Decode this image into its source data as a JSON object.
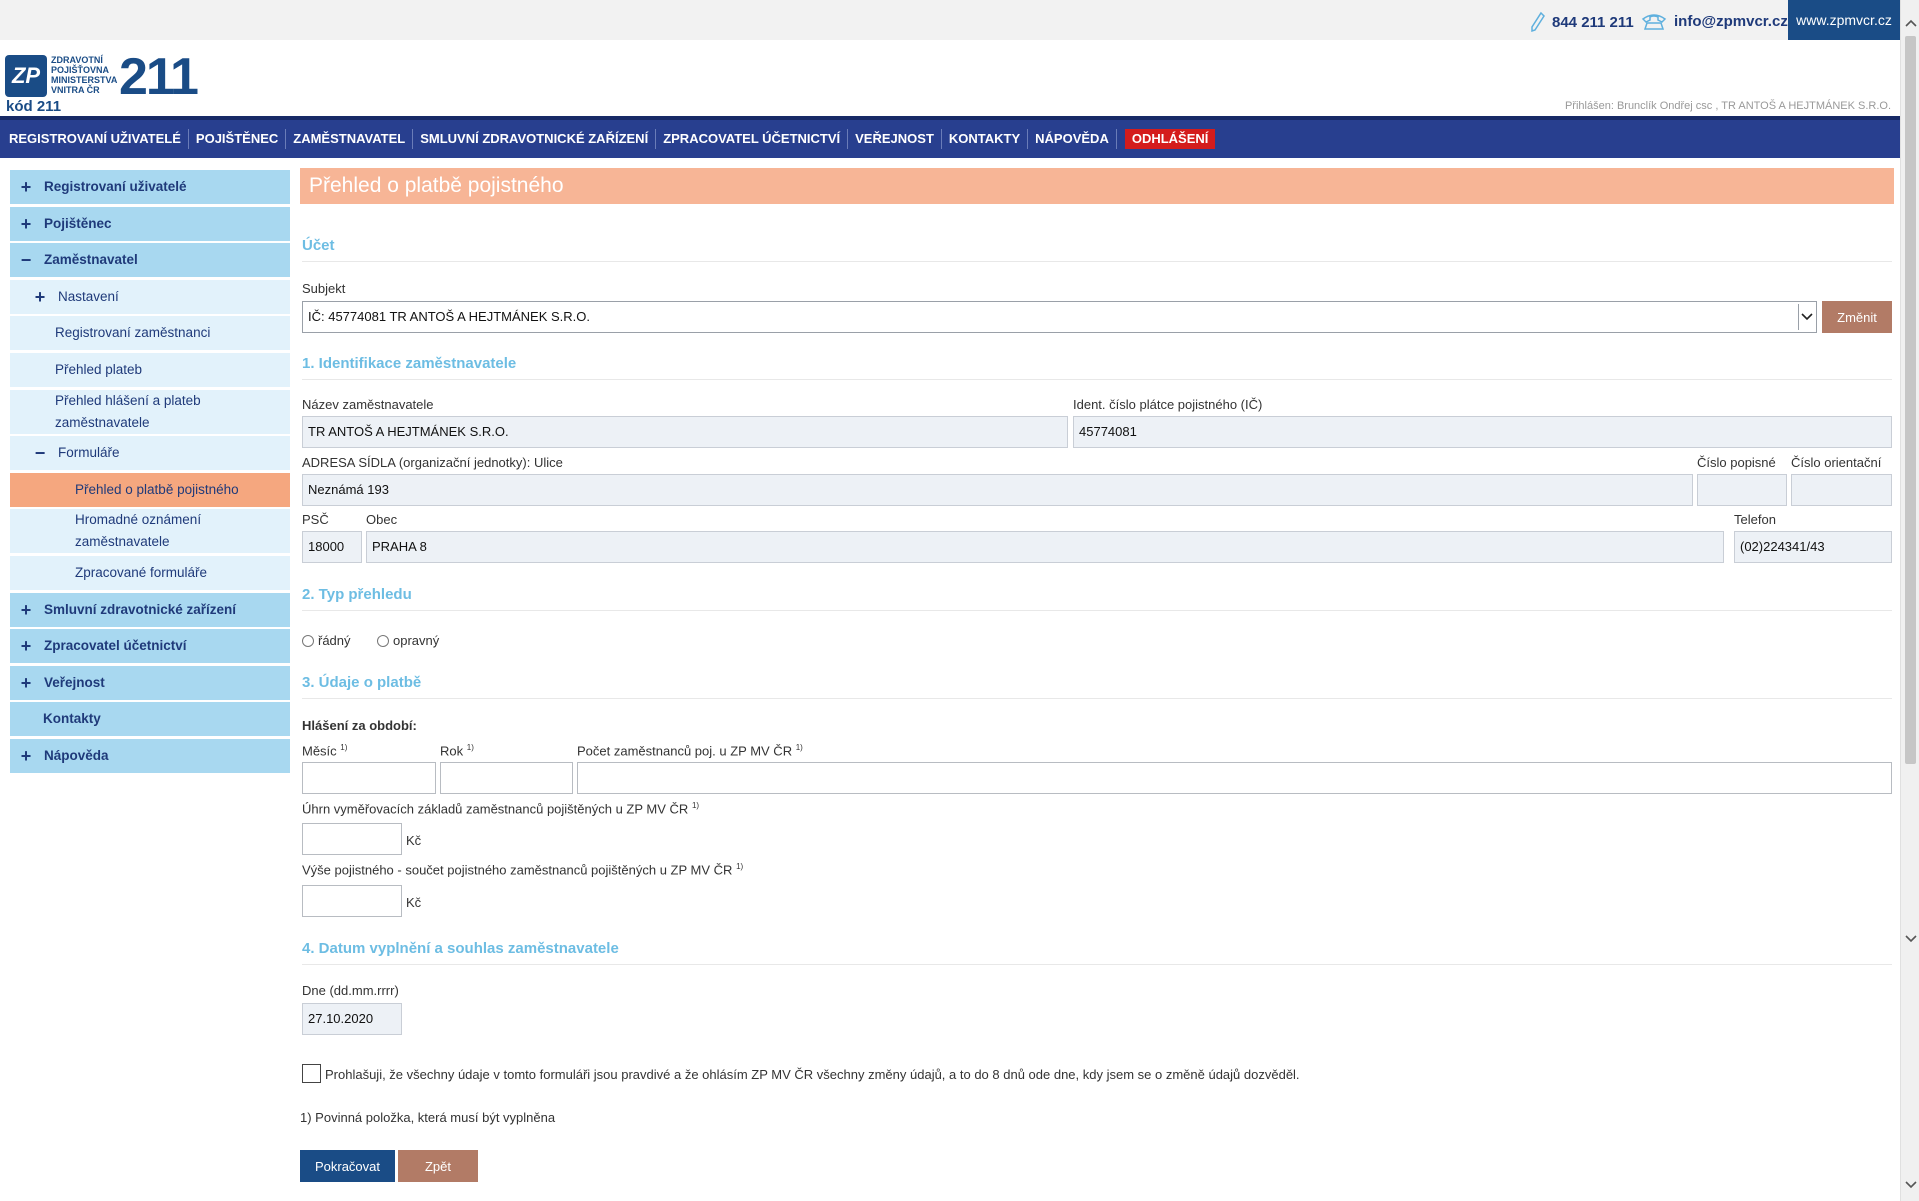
{
  "topbar": {
    "phone": "844 211 211",
    "email": "info@zpmvcr.cz",
    "website": "www.zpmvcr.cz"
  },
  "header": {
    "logo_mark": "ZP",
    "logo_lines": [
      "ZDRAVOTNÍ",
      "POJIŠŤOVNA",
      "MINISTERSTVA",
      "VNITRA ČR"
    ],
    "logo_number": "211",
    "logo_code": "kód 211",
    "login_info": "Přihlášen: Bruncl­ík Ondřej csc , TR ANTOŠ A HEJTMÁNEK S.R.O."
  },
  "nav": {
    "items": [
      "REGISTROVANÍ UŽIVATELÉ",
      "POJIŠTĚNEC",
      "ZAMĚSTNAVATEL",
      "SMLUVNÍ ZDRAVOTNICKÉ ZAŘÍZENÍ",
      "ZPRACOVATEL ÚČETNICTVÍ",
      "VEŘEJNOST",
      "KONTAKTY",
      "NÁPOVĚDA"
    ],
    "logout": "ODHLÁŠENÍ"
  },
  "sidebar": {
    "items": [
      {
        "sign": "+",
        "label": "Registrovaní uživatelé"
      },
      {
        "sign": "+",
        "label": "Pojištěnec"
      },
      {
        "sign": "−",
        "label": "Zaměstnavatel"
      },
      {
        "sign": "+",
        "label": "Nastavení"
      },
      {
        "sign": "",
        "label": "Registrovaní zaměstnanci"
      },
      {
        "sign": "",
        "label": "Přehled plateb"
      },
      {
        "sign": "",
        "label": "Přehled hlášení a plateb zaměstnavatele"
      },
      {
        "sign": "−",
        "label": "Formuláře"
      },
      {
        "sign": "",
        "label": "Přehled o platbě pojistného"
      },
      {
        "sign": "",
        "label": "Hromadné oznámení zaměstnavatele"
      },
      {
        "sign": "",
        "label": "Zpracované formuláře"
      },
      {
        "sign": "+",
        "label": "Smluvní zdravotnické zařízení"
      },
      {
        "sign": "+",
        "label": "Zpracovatel účetnictví"
      },
      {
        "sign": "+",
        "label": "Veřejnost"
      },
      {
        "sign": "",
        "label": "Kontakty"
      },
      {
        "sign": "+",
        "label": "Nápověda"
      }
    ]
  },
  "page": {
    "title": "Přehled o platbě pojistného",
    "account": {
      "heading": "Účet",
      "subject_label": "Subjekt",
      "subject_value": "IČ: 45774081   TR ANTOŠ A HEJTMÁNEK S.R.O.",
      "change_button": "Změnit"
    },
    "section1": {
      "heading": "1. Identifikace zaměstnavatele",
      "name_label": "Název zaměstnavatele",
      "name_value": "TR ANTOŠ A HEJTMÁNEK S.R.O.",
      "ic_label": "Ident. číslo plátce pojistného (IČ)",
      "ic_value": "45774081",
      "street_label": "ADRESA SÍDLA (organizační jednotky): Ulice",
      "street_value": "Neznámá 193",
      "cp_label": "Číslo popisné",
      "cp_value": "",
      "co_label": "Číslo orientační",
      "co_value": "",
      "psc_label": "PSČ",
      "psc_value": "18000",
      "city_label": "Obec",
      "city_value": "PRAHA 8",
      "phone_label": "Telefon",
      "phone_value": "(02)224341/43"
    },
    "section2": {
      "heading": "2. Typ přehledu",
      "option1": "řádný",
      "option2": "opravný"
    },
    "section3": {
      "heading": "3. Údaje o platbě",
      "period_label": "Hlášení za období:",
      "month_label": "Měsíc",
      "year_label": "Rok",
      "count_label": "Počet zaměstnanců poj. u ZP MV ČR",
      "footnote_mark": "1)",
      "base_label": "Úhrn vyměřovacích základů zaměstnanců pojištěných u ZP MV ČR",
      "premium_label": "Výše pojistného - součet pojistného zaměstnanců pojištěných u ZP MV ČR",
      "currency": "Kč"
    },
    "section4": {
      "heading": "4. Datum vyplnění a souhlas zaměstnavatele",
      "date_label": "Dne (dd.mm.rrrr)",
      "date_value": "27.10.2020",
      "declaration": "Prohlašuji, že všechny údaje v tomto formuláři jsou pravdivé a že ohlásím ZP MV ČR všechny změny údajů, a to do 8 dnů ode dne, kdy jsem se o změně údajů dozvěděl.",
      "footnote": "1) Povinná položka, která musí být vyplněna"
    },
    "buttons": {
      "continue": "Pokračovat",
      "back": "Zpět"
    }
  },
  "colors": {
    "brand_blue": "#1a4c86",
    "nav_blue": "#283f8f",
    "title_orange": "#f7b596",
    "section_cyan": "#6dbde3",
    "logout_red": "#d41c1c",
    "button_brown": "#b27b66"
  }
}
